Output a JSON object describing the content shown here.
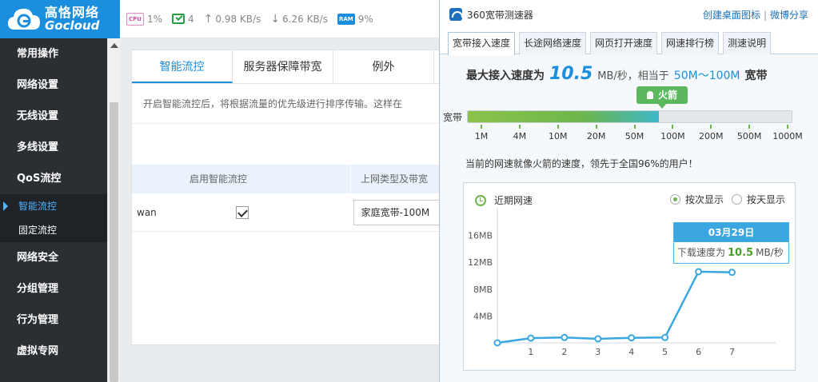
{
  "logo": {
    "cn": "高恪网络",
    "en": "Gocloud"
  },
  "status": {
    "cpu_chip": "CPU",
    "cpu": "1%",
    "conn": "4",
    "up": "0.98 KB/s",
    "down": "6.26 KB/s",
    "ram_chip": "RAM",
    "ram": "9%"
  },
  "sidebar": {
    "items": [
      "常用操作",
      "网络设置",
      "无线设置",
      "多线设置",
      "QoS流控"
    ],
    "sub": [
      "智能流控",
      "固定流控"
    ],
    "items2": [
      "网络安全",
      "分组管理",
      "行为管理",
      "虚拟专网"
    ]
  },
  "panel": {
    "tabs": [
      "智能流控",
      "服务器保障带宽",
      "例外"
    ],
    "desc": "开启智能流控后，将根据流量的优先级进行排序传输。这样在",
    "table": {
      "headers": [
        "",
        "启用智能流控",
        "上网类型及带宽"
      ],
      "row": {
        "iface": "wan",
        "type": "家庭宽带-100M"
      }
    }
  },
  "tester": {
    "title": "360宽带测速器",
    "links": [
      "创建桌面图标",
      "微博分享"
    ],
    "tabs": [
      "宽带接入速度",
      "长途网络速度",
      "网页打开速度",
      "网速排行榜",
      "测速说明"
    ],
    "max_label": "最大接入速度为",
    "max_value": "10.5",
    "max_unit": "MB/秒，相当于",
    "max_range": "50M～100M",
    "max_suffix": "宽带",
    "badge": "火箭",
    "bar_label": "宽带",
    "bar_fill_percent": 59,
    "scale": [
      "1M",
      "4M",
      "10M",
      "20M",
      "50M",
      "100M",
      "200M",
      "500M",
      "1000M"
    ],
    "summary": "当前的网速就像火箭的速度，领先于全国96%的用户！",
    "chart_title": "近期网速",
    "radio_times": "按次显示",
    "radio_days": "按天显示",
    "tooltip": {
      "date": "03月29日",
      "label": "下载速度为",
      "value": "10.5",
      "unit": "MB/秒"
    }
  },
  "chart_data": {
    "type": "line",
    "title": "近期网速",
    "x": [
      0,
      1,
      2,
      3,
      4,
      5,
      6,
      7
    ],
    "xticks": [
      "1",
      "2",
      "3",
      "4",
      "5",
      "6",
      "7"
    ],
    "values": [
      0,
      0.7,
      0.8,
      0.6,
      0.75,
      0.8,
      10.6,
      10.5
    ],
    "yticks": [
      "4MB",
      "8MB",
      "12MB",
      "16MB"
    ],
    "ylim": [
      0,
      20
    ],
    "color": "#3aa7e0"
  }
}
